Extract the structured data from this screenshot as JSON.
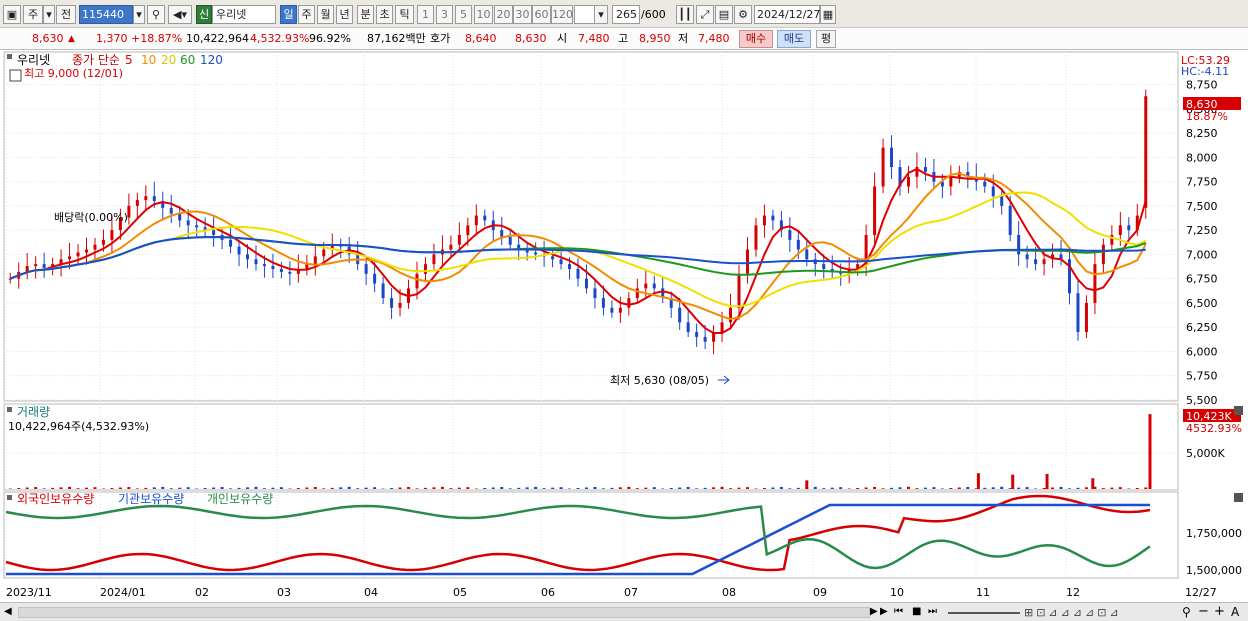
{
  "toolbar": {
    "market_sel": "주",
    "prev_label": "전",
    "code": "115440",
    "type_badge": "신",
    "stock_name": "우리넷",
    "period_tabs": [
      "일",
      "주",
      "월",
      "년",
      "분",
      "초",
      "틱"
    ],
    "period_active": "일",
    "interval_btns": [
      "1",
      "3",
      "5",
      "10",
      "20",
      "30",
      "60",
      "120"
    ],
    "count": "265",
    "count_max": "/600",
    "date": "2024/12/27"
  },
  "quote": {
    "price": "8,630",
    "change": "1,370",
    "change_pct": "+18.87%",
    "volume": "10,422,964",
    "volume_ratio": "4,532.93%",
    "turnover": "96.92%",
    "amount": "87,162백만",
    "bid_label": "호가",
    "bid": "8,640",
    "ask": "8,630",
    "open_label": "시",
    "open": "7,480",
    "high_label": "고",
    "high": "8,950",
    "low_label": "저",
    "low": "7,480",
    "buy_btn": "매수",
    "sell_btn": "매도",
    "eval_btn": "평"
  },
  "price_panel": {
    "legend_name": "우리넷",
    "legend_type": "종가 단순",
    "ma_labels": [
      "5",
      "10",
      "20",
      "60",
      "120"
    ],
    "ma_colors": [
      "#e00000",
      "#f28c00",
      "#f0e000",
      "#1a9a1a",
      "#1a4fd0"
    ],
    "high_note": "최고 9,000 (12/01)",
    "low_note": "최저 5,630 (08/05)",
    "dividend_note": "배당락(0.00%)",
    "lc": "LC:53.29",
    "hc": "HC:-4.11",
    "last_price_tag": "8,630",
    "last_pct": "18.87%",
    "yticks": [
      "8,750",
      "8,500",
      "8,250",
      "8,000",
      "7,750",
      "7,500",
      "7,250",
      "7,000",
      "6,750",
      "6,500",
      "6,250",
      "6,000",
      "5,750",
      "5,500"
    ]
  },
  "volume_panel": {
    "title": "거래량",
    "value_text": "10,422,964주(4,532.93%)",
    "tag": "10,423K",
    "tag_pct": "4532.93%",
    "ytick": "5,000K"
  },
  "holdings_panel": {
    "legend": [
      "외국인보유수량",
      "기관보유수량",
      "개인보유수량"
    ],
    "legend_colors": [
      "#d60000",
      "#1a4fd0",
      "#2a8a4a"
    ],
    "yticks": [
      "1,750,000",
      "1,500,000"
    ]
  },
  "xaxis": {
    "labels": [
      "2023/11",
      "2024/01",
      "02",
      "03",
      "04",
      "05",
      "06",
      "07",
      "08",
      "09",
      "10",
      "11",
      "12"
    ],
    "end_label": "12/27"
  },
  "chart_data": {
    "type": "candlestick",
    "date_range": [
      "2023/11",
      "2024/12/27"
    ],
    "price_ylim": [
      5500,
      8900
    ],
    "ma_periods": [
      5,
      10,
      20,
      60,
      120
    ],
    "closes": [
      6750,
      6820,
      6880,
      6900,
      6860,
      6900,
      6950,
      6980,
      7020,
      7050,
      7100,
      7150,
      7250,
      7380,
      7500,
      7560,
      7600,
      7550,
      7480,
      7420,
      7350,
      7300,
      7280,
      7250,
      7200,
      7150,
      7080,
      7000,
      6950,
      6900,
      6880,
      6850,
      6820,
      6800,
      6850,
      6900,
      6980,
      7050,
      7100,
      7080,
      7000,
      6900,
      6800,
      6700,
      6550,
      6450,
      6500,
      6650,
      6800,
      6900,
      7000,
      7050,
      7100,
      7200,
      7300,
      7400,
      7350,
      7250,
      7180,
      7100,
      7050,
      7020,
      7000,
      6980,
      6950,
      6900,
      6850,
      6750,
      6650,
      6550,
      6450,
      6400,
      6450,
      6550,
      6650,
      6700,
      6650,
      6550,
      6450,
      6300,
      6200,
      6150,
      6100,
      6200,
      6300,
      6450,
      6800,
      7050,
      7300,
      7400,
      7350,
      7250,
      7150,
      7050,
      6950,
      6900,
      6850,
      6820,
      6800,
      6850,
      6900,
      7200,
      7700,
      8100,
      7900,
      7700,
      7800,
      7900,
      7850,
      7750,
      7700,
      7800,
      7850,
      7800,
      7750,
      7700,
      7600,
      7500,
      7200,
      7000,
      6950,
      6900,
      6950,
      7000,
      6950,
      6600,
      6200,
      6500,
      6900,
      7100,
      7200,
      7300,
      7250,
      7400,
      8630
    ],
    "volume_spikes_K": [
      [
        0.7,
        1200
      ],
      [
        0.85,
        2200
      ],
      [
        0.88,
        2000
      ],
      [
        0.91,
        2100
      ],
      [
        0.95,
        1500
      ],
      [
        1.0,
        10423
      ]
    ],
    "volume_ytick_K": 5000,
    "holdings_ylim": [
      1440000,
      1900000
    ],
    "holdings_series": [
      "외국인보유수량",
      "기관보유수량",
      "개인보유수량"
    ]
  }
}
